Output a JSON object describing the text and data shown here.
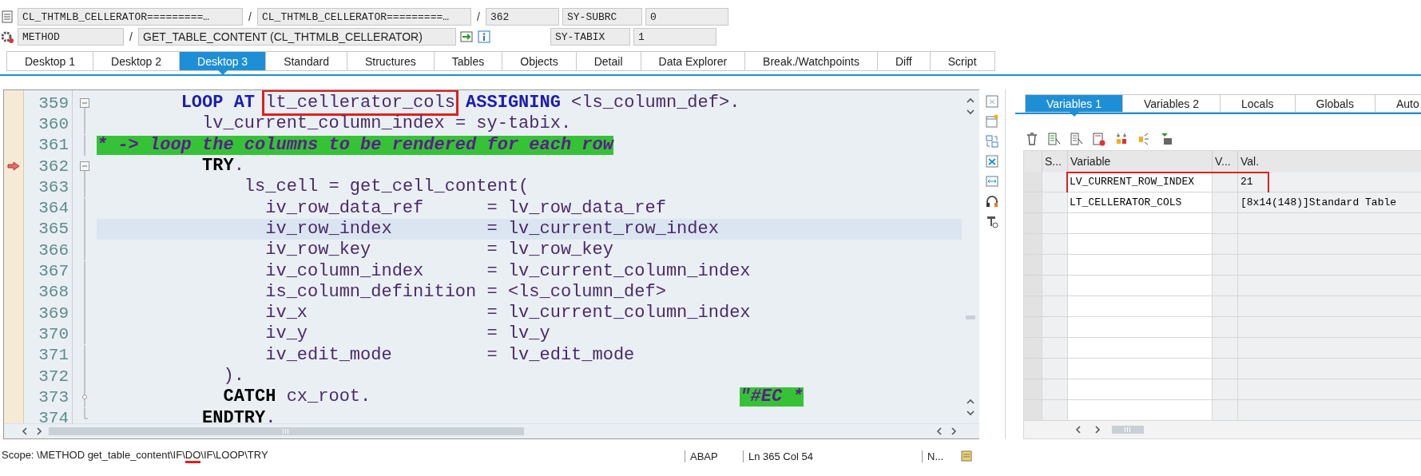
{
  "header": {
    "row1": {
      "include": "CL_THTMLB_CELLERATOR=========…",
      "program": "CL_THTMLB_CELLERATOR=========…",
      "line": "362",
      "sys_field": "SY-SUBRC",
      "sys_value": "0"
    },
    "row2": {
      "event_type": "METHOD",
      "event": "GET_TABLE_CONTENT (CL_THTMLB_CELLERATOR)",
      "sys_field": "SY-TABIX",
      "sys_value": "1"
    },
    "separators": [
      "/",
      "/",
      "/"
    ]
  },
  "tabs": [
    {
      "label": "Desktop 1",
      "selected": false
    },
    {
      "label": "Desktop 2",
      "selected": false
    },
    {
      "label": "Desktop 3",
      "selected": true
    },
    {
      "label": "Standard",
      "selected": false
    },
    {
      "label": "Structures",
      "selected": false
    },
    {
      "label": "Tables",
      "selected": false
    },
    {
      "label": "Objects",
      "selected": false
    },
    {
      "label": "Detail",
      "selected": false
    },
    {
      "label": "Data Explorer",
      "selected": false
    },
    {
      "label": "Break./Watchpoints",
      "selected": false
    },
    {
      "label": "Diff",
      "selected": false
    },
    {
      "label": "Script",
      "selected": false
    }
  ],
  "editor": {
    "lines": [
      {
        "number": "359",
        "kind": "fold_open",
        "executing": false,
        "highlighted": false,
        "code": [
          {
            "kind": "keyword",
            "text": "        LOOP AT "
          },
          {
            "kind": "plain",
            "text": "lt_cellerator_cols",
            "boxed": true
          },
          {
            "kind": "keyword",
            "text": " ASSIGNING"
          },
          {
            "kind": "plain",
            "text": " <ls_column_def>."
          }
        ]
      },
      {
        "number": "360",
        "kind": "fold_line",
        "executing": false,
        "highlighted": false,
        "code": [
          {
            "kind": "plain",
            "text": "          lv_current_column_index = sy-tabix."
          }
        ]
      },
      {
        "number": "361",
        "kind": "fold_line",
        "executing": false,
        "highlighted": false,
        "code": [
          {
            "kind": "comment",
            "text": "* -> loop the columns to be rendered for each row"
          }
        ]
      },
      {
        "number": "362",
        "kind": "fold_open",
        "executing": true,
        "highlighted": false,
        "code": [
          {
            "kind": "control",
            "text": "          TRY"
          },
          {
            "kind": "plain",
            "text": "."
          }
        ]
      },
      {
        "number": "363",
        "kind": "fold_line",
        "executing": false,
        "highlighted": false,
        "code": [
          {
            "kind": "plain",
            "text": "              ls_cell = get_cell_content("
          }
        ]
      },
      {
        "number": "364",
        "kind": "fold_line",
        "executing": false,
        "highlighted": false,
        "code": [
          {
            "kind": "plain",
            "text": "                iv_row_data_ref      = lv_row_data_ref"
          }
        ]
      },
      {
        "number": "365",
        "kind": "fold_line",
        "executing": false,
        "highlighted": true,
        "code": [
          {
            "kind": "plain",
            "text": "                iv_row_index         = lv_current_row_index"
          }
        ]
      },
      {
        "number": "366",
        "kind": "fold_line",
        "executing": false,
        "highlighted": false,
        "code": [
          {
            "kind": "plain",
            "text": "                iv_row_key           = lv_row_key"
          }
        ]
      },
      {
        "number": "367",
        "kind": "fold_line",
        "executing": false,
        "highlighted": false,
        "code": [
          {
            "kind": "plain",
            "text": "                iv_column_index      = lv_current_column_index"
          }
        ]
      },
      {
        "number": "368",
        "kind": "fold_line",
        "executing": false,
        "highlighted": false,
        "code": [
          {
            "kind": "plain",
            "text": "                is_column_definition = <ls_column_def>"
          }
        ]
      },
      {
        "number": "369",
        "kind": "fold_line",
        "executing": false,
        "highlighted": false,
        "code": [
          {
            "kind": "plain",
            "text": "                iv_x                 = lv_current_column_index"
          }
        ]
      },
      {
        "number": "370",
        "kind": "fold_line",
        "executing": false,
        "highlighted": false,
        "code": [
          {
            "kind": "plain",
            "text": "                iv_y                 = lv_y"
          }
        ]
      },
      {
        "number": "371",
        "kind": "fold_line",
        "executing": false,
        "highlighted": false,
        "code": [
          {
            "kind": "plain",
            "text": "                iv_edit_mode         = lv_edit_mode"
          }
        ]
      },
      {
        "number": "372",
        "kind": "fold_line",
        "executing": false,
        "highlighted": false,
        "code": [
          {
            "kind": "plain",
            "text": "            )."
          }
        ]
      },
      {
        "number": "373",
        "kind": "fold_node",
        "executing": false,
        "highlighted": false,
        "code": [
          {
            "kind": "control",
            "text": "            CATCH"
          },
          {
            "kind": "plain",
            "text": " cx_root."
          }
        ],
        "end_comment": "\"#EC *"
      },
      {
        "number": "374",
        "kind": "fold_end",
        "executing": false,
        "highlighted": false,
        "code": [
          {
            "kind": "control",
            "text": "          ENDTRY"
          },
          {
            "kind": "plain",
            "text": "."
          }
        ]
      }
    ]
  },
  "variables": {
    "tabs": [
      {
        "label": "Variables 1",
        "selected": true
      },
      {
        "label": "Variables 2",
        "selected": false
      },
      {
        "label": "Locals",
        "selected": false
      },
      {
        "label": "Globals",
        "selected": false
      },
      {
        "label": "Auto",
        "selected": false
      }
    ],
    "columns": [
      "S...",
      "Variable",
      "V...",
      "Val."
    ],
    "rows": [
      {
        "variable": "LV_CURRENT_ROW_INDEX",
        "value": "21",
        "boxed": true
      },
      {
        "variable": "LT_CELLERATOR_COLS",
        "value": "[8x14(148)]Standard Table",
        "boxed": false
      }
    ]
  },
  "status_bar": {
    "scope": [
      {
        "text": "Scope: \\METHOD get_table_content\\IF\\",
        "marked": false
      },
      {
        "text": "DO",
        "marked": true
      },
      {
        "text": "\\IF\\LOOP\\TRY",
        "marked": false
      }
    ],
    "language": "ABAP",
    "position": "Ln 365 Col 54",
    "mode": "N..."
  }
}
